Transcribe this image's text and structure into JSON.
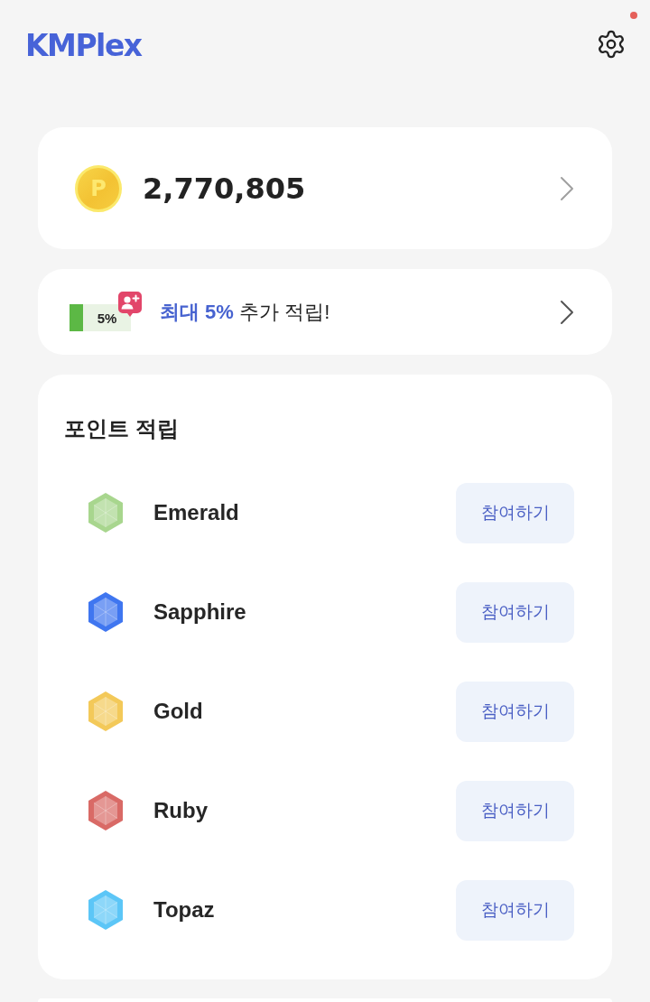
{
  "header": {
    "logo": "KMPlex",
    "settings": {
      "notification": true
    }
  },
  "points": {
    "coin_label": "P",
    "balance": "2,770,805"
  },
  "promo": {
    "coupon_label": "5%",
    "text": "**최대 5%** 추가 적립!"
  },
  "earn": {
    "title": "포인트 적립",
    "items": [
      {
        "name": "Emerald",
        "color": "#a8d68e",
        "action": "참여하기"
      },
      {
        "name": "Sapphire",
        "color": "#3f76f0",
        "action": "참여하기"
      },
      {
        "name": "Gold",
        "color": "#f3c959",
        "action": "참여하기"
      },
      {
        "name": "Ruby",
        "color": "#d96a66",
        "action": "참여하기"
      },
      {
        "name": "Topaz",
        "color": "#5cc6f7",
        "action": "참여하기"
      }
    ]
  }
}
